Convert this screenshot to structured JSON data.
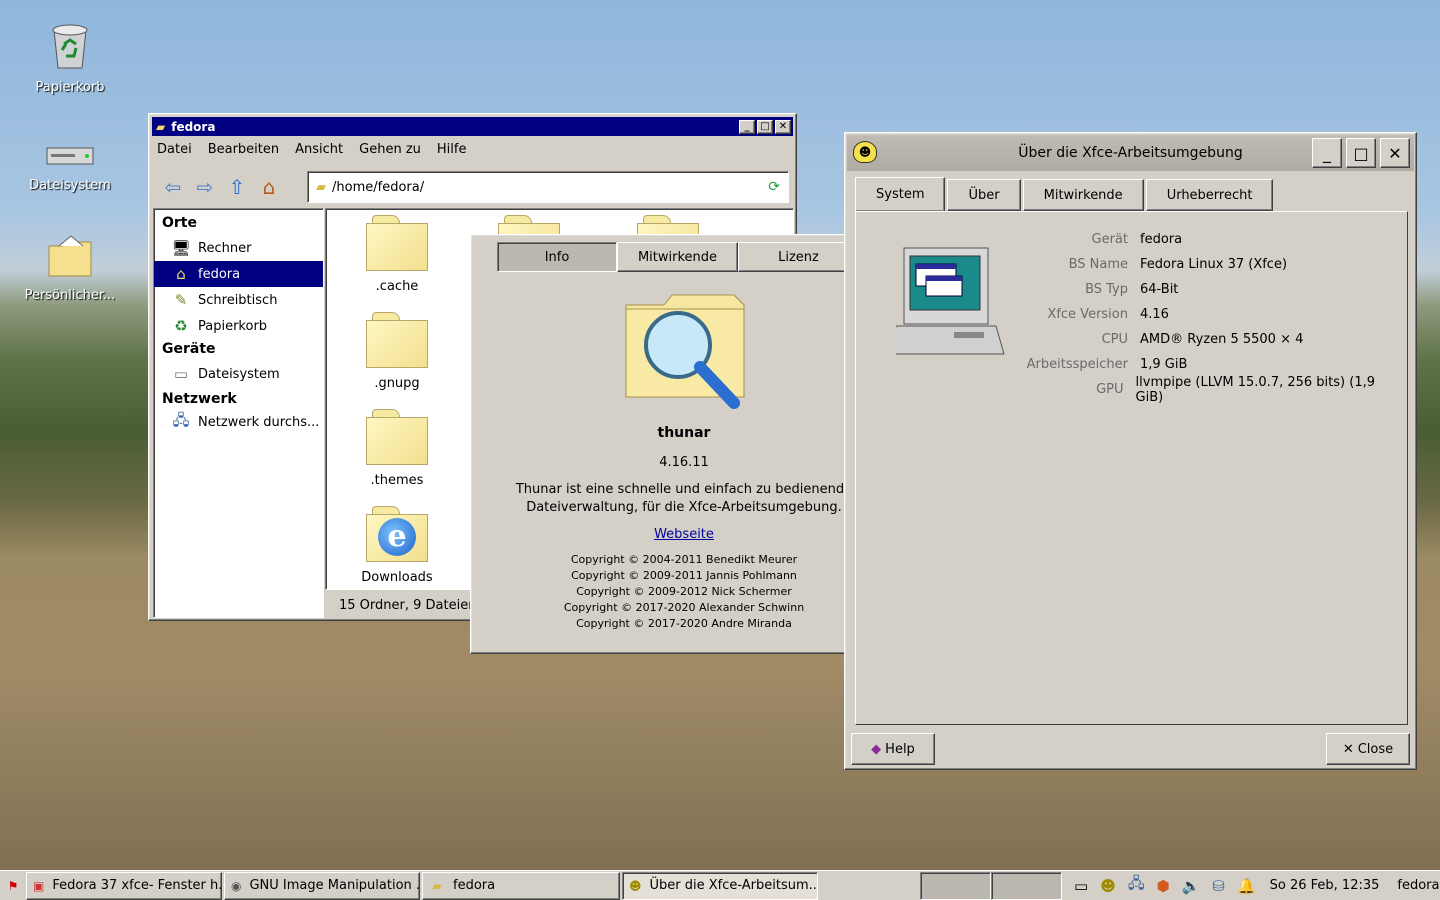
{
  "desktop": {
    "icons": [
      {
        "label": "Papierkorb"
      },
      {
        "label": "Dateisystem"
      },
      {
        "label": "Persönlicher..."
      }
    ]
  },
  "thunar": {
    "title": "fedora",
    "menu": [
      "Datei",
      "Bearbeiten",
      "Ansicht",
      "Gehen zu",
      "Hilfe"
    ],
    "location": "/home/fedora/",
    "sidebar": {
      "sections": [
        {
          "heading": "Orte",
          "items": [
            "Rechner",
            "fedora",
            "Schreibtisch",
            "Papierkorb"
          ]
        },
        {
          "heading": "Geräte",
          "items": [
            "Dateisystem"
          ]
        },
        {
          "heading": "Netzwerk",
          "items": [
            "Netzwerk durchs..."
          ]
        }
      ],
      "selected": "fedora"
    },
    "files": [
      ".cache",
      ".gnupg",
      ".themes",
      "Downloads"
    ],
    "status": "15 Ordner, 9 Dateien."
  },
  "thunar_about": {
    "tabs": [
      "Info",
      "Mitwirkende",
      "Lizenz"
    ],
    "active_tab": "Info",
    "close_symbol": "✕",
    "app_name": "thunar",
    "version": "4.16.11",
    "description_line1": "Thunar ist eine schnelle und einfach zu bedienende",
    "description_line2": "Dateiverwaltung, für die Xfce-Arbeitsumgebung.",
    "website": "Webseite",
    "copyrights": [
      "Copyright © 2004-2011 Benedikt Meurer",
      "Copyright © 2009-2011 Jannis Pohlmann",
      "Copyright © 2009-2012 Nick Schermer",
      "Copyright © 2017-2020 Alexander Schwinn",
      "Copyright © 2017-2020 Andre Miranda"
    ]
  },
  "xfce_about": {
    "title": "Über die Xfce-Arbeitsumgebung",
    "tabs": [
      "System",
      "Über",
      "Mitwirkende",
      "Urheberrecht"
    ],
    "active_tab": "System",
    "info": [
      {
        "key": "Gerät",
        "value": "fedora"
      },
      {
        "key": "BS Name",
        "value": "Fedora Linux 37 (Xfce)"
      },
      {
        "key": "BS Typ",
        "value": "64-Bit"
      },
      {
        "key": "Xfce Version",
        "value": "4.16"
      },
      {
        "key": "CPU",
        "value": "AMD® Ryzen 5 5500 × 4"
      },
      {
        "key": "Arbeitsspeicher",
        "value": "1,9 GiB"
      },
      {
        "key": "GPU",
        "value": "llvmpipe (LLVM 15.0.7, 256 bits) (1,9 GiB)"
      }
    ],
    "help_label": "Help",
    "close_label": "Close"
  },
  "taskbar": {
    "tasks": [
      "Fedora 37 xfce- Fenster h...",
      "GNU Image Manipulation ...",
      "fedora",
      "Über die Xfce-Arbeitsum..."
    ],
    "clock": "So 26 Feb, 12:35",
    "user": "fedora"
  },
  "colors": {
    "titlebar_active": "#000080",
    "window_face": "#d4d0c8",
    "selection": "#000080"
  }
}
